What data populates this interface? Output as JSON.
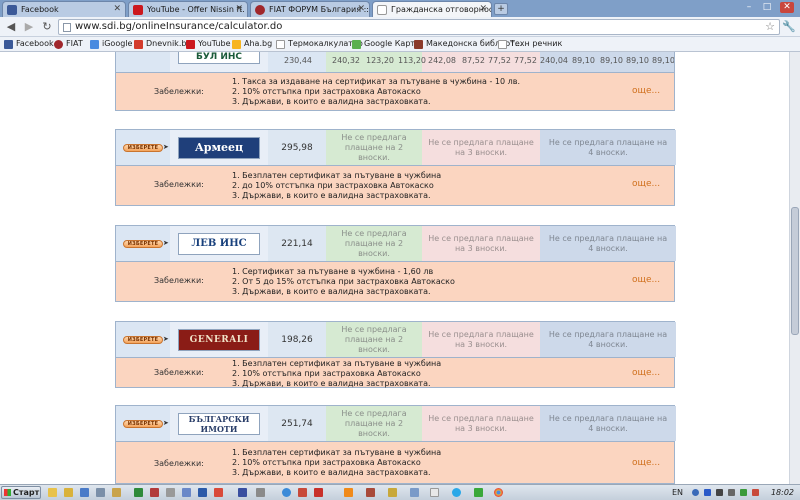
{
  "tabs": [
    {
      "label": "Facebook",
      "active": false,
      "icon": "facebook-icon"
    },
    {
      "label": "YouTube - Offer Nissin ft. ...",
      "active": false,
      "icon": "youtube-icon"
    },
    {
      "label": "FIAT ФОРУМ България :: ...",
      "active": false,
      "icon": "fiat-icon"
    },
    {
      "label": "Гражданска отговорност...",
      "active": true,
      "icon": "page-icon"
    }
  ],
  "address": {
    "url": "www.sdi.bg/onlineInsurance/calculator.do"
  },
  "bookmarks": [
    {
      "label": "Facebook",
      "icon": "facebook-icon"
    },
    {
      "label": "FIAT",
      "icon": "fiat-icon"
    },
    {
      "label": "iGoogle",
      "icon": "google-icon"
    },
    {
      "label": "Dnevnik.bg",
      "icon": "dnevnik-icon"
    },
    {
      "label": "YouTube",
      "icon": "youtube-icon"
    },
    {
      "label": "Aha.bg",
      "icon": "aha-icon"
    },
    {
      "label": "Термокалкулатор",
      "icon": "page-icon"
    },
    {
      "label": "Google Карти",
      "icon": "maps-icon"
    },
    {
      "label": "Македонска библиот...",
      "icon": "book-icon"
    },
    {
      "label": "Техн речник",
      "icon": "page-icon"
    }
  ],
  "top_partial": {
    "values": [
      "230,44",
      "240,32",
      "123,20",
      "113,20",
      "242,08",
      "87,52",
      "77,52",
      "77,52",
      "240,04",
      "89,10",
      "89,10",
      "89,10",
      "89,10"
    ]
  },
  "top_notes": {
    "label": "Забележки:",
    "items": [
      "1. Такса за издаване на сертификат за пътуване в чужбина - 10 лв.",
      "2. 10% отстъпка при застраховка Автокаско",
      "3. Държави, в които е валидна застраховката."
    ],
    "more": "още..."
  },
  "choose_label": "ИЗБЕРЕТЕ",
  "insurers": [
    {
      "name": "Армеец",
      "logo_style": "armeec",
      "price": "295,98",
      "col2": "Не се предлага плащане на 2 вноски.",
      "col3": "Не се предлага плащане на 3 вноски.",
      "col4": "Не се предлага плащане на 4 вноски.",
      "notes_label": "Забележки:",
      "notes": [
        "1. Безплатен сертификат за пътуване в чужбина",
        "2. до 10% отстъпка при застраховка Автокаско",
        "3. Държави, в които е валидна застраховката."
      ],
      "more": "още..."
    },
    {
      "name": "ЛЕВ ИНС",
      "logo_style": "lev",
      "price": "221,14",
      "col2": "Не се предлага плащане на 2 вноски.",
      "col3": "Не се предлага плащане на 3 вноски.",
      "col4": "Не се предлага плащане на 4 вноски.",
      "notes_label": "Забележки:",
      "notes": [
        "1. Сертификат за пътуване в чужбина - 1,60 лв",
        "2. От 5 до 15% отстъпка при застраховка Автокаско",
        "3. Държави, в които е валидна застраховката."
      ],
      "more": "още..."
    },
    {
      "name": "GENERALI",
      "logo_style": "generali",
      "price": "198,26",
      "col2": "Не се предлага плащане на 2 вноски.",
      "col3": "Не се предлага плащане на 3 вноски.",
      "col4": "Не се предлага плащане на 4 вноски.",
      "notes_label": "Забележки:",
      "notes": [
        "1. Безплатен сертификат за пътуване в чужбина",
        "2. 10% отстъпка при застраховка Автокаско",
        "3. Държави, в които е валидна застраховката."
      ],
      "more": "още..."
    },
    {
      "name": "БЪЛГАРСКИ ИМОТИ",
      "logo_style": "bul",
      "price": "251,74",
      "col2": "Не се предлага плащане на 2 вноски.",
      "col3": "Не се предлага плащане на 3 вноски.",
      "col4": "Не се предлага плащане на 4 вноски.",
      "notes_label": "Забележки:",
      "notes": [
        "1. Безплатен сертификат за пътуване в чужбина",
        "2. 10% отстъпка при застраховка Автокаско",
        "3. Държави, в които е валидна застраховката."
      ],
      "more": "още..."
    }
  ],
  "taskbar": {
    "start_label": "Старт",
    "lang": "EN",
    "clock": "18:02"
  },
  "colors": {
    "notes_bg": "#fbd5c0",
    "more_link": "#d0701d",
    "col2_bg": "#d6ead2",
    "col3_bg": "#f5dede",
    "col4_bg": "#cdd9ea"
  }
}
